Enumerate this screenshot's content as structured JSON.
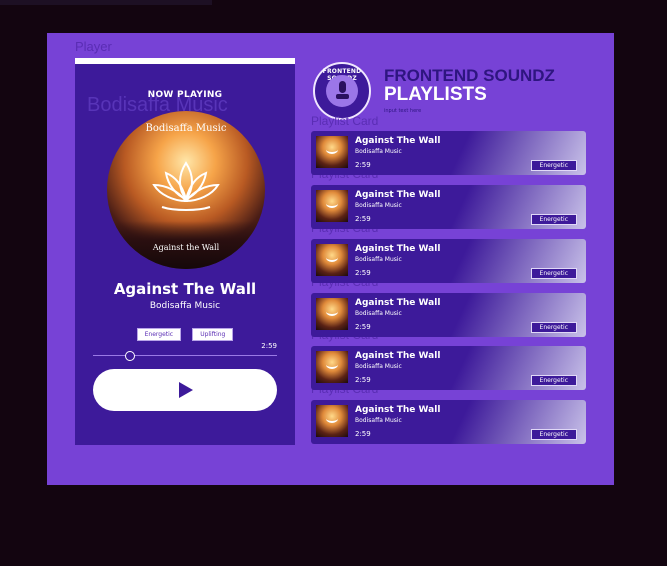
{
  "frame": {
    "label": "Player"
  },
  "player": {
    "ghost_text": "Bodisaffa Music",
    "now_playing": "NOW PLAYING",
    "album_title": "Bodisaffa Music",
    "album_subtitle": "Against the Wall",
    "track_title": "Against The Wall",
    "artist": "Bodisaffa Music",
    "tags": [
      "Energetic",
      "Uplifting"
    ],
    "duration": "2:59",
    "progress_fraction": 0.2
  },
  "header": {
    "logo_text": "FRONTEND SOUNDZ",
    "brand_line1": "FRONTEND SOUNDZ",
    "brand_line2": "PLAYLISTS",
    "brand_small": "input text here"
  },
  "playlist": {
    "card_label": "Playlist Card",
    "items": [
      {
        "title": "Against The Wall",
        "artist": "Bodisaffa Music",
        "time": "2:59",
        "tag": "Energetic"
      },
      {
        "title": "Against The Wall",
        "artist": "Bodisaffa Music",
        "time": "2:59",
        "tag": "Energetic"
      },
      {
        "title": "Against The Wall",
        "artist": "Bodisaffa Music",
        "time": "2:59",
        "tag": "Energetic"
      },
      {
        "title": "Against The Wall",
        "artist": "Bodisaffa Music",
        "time": "2:59",
        "tag": "Energetic"
      },
      {
        "title": "Against The Wall",
        "artist": "Bodisaffa Music",
        "time": "2:59",
        "tag": "Energetic"
      },
      {
        "title": "Against The Wall",
        "artist": "Bodisaffa Music",
        "time": "2:59",
        "tag": "Energetic"
      }
    ]
  },
  "colors": {
    "frame": "#7742d6",
    "player_bg": "#3d1a9a",
    "brand_dark": "#2e1580",
    "page_bg": "#130510"
  },
  "icons": {
    "play": "play-icon",
    "logo": "microphone-icon",
    "album": "lotus-icon"
  }
}
